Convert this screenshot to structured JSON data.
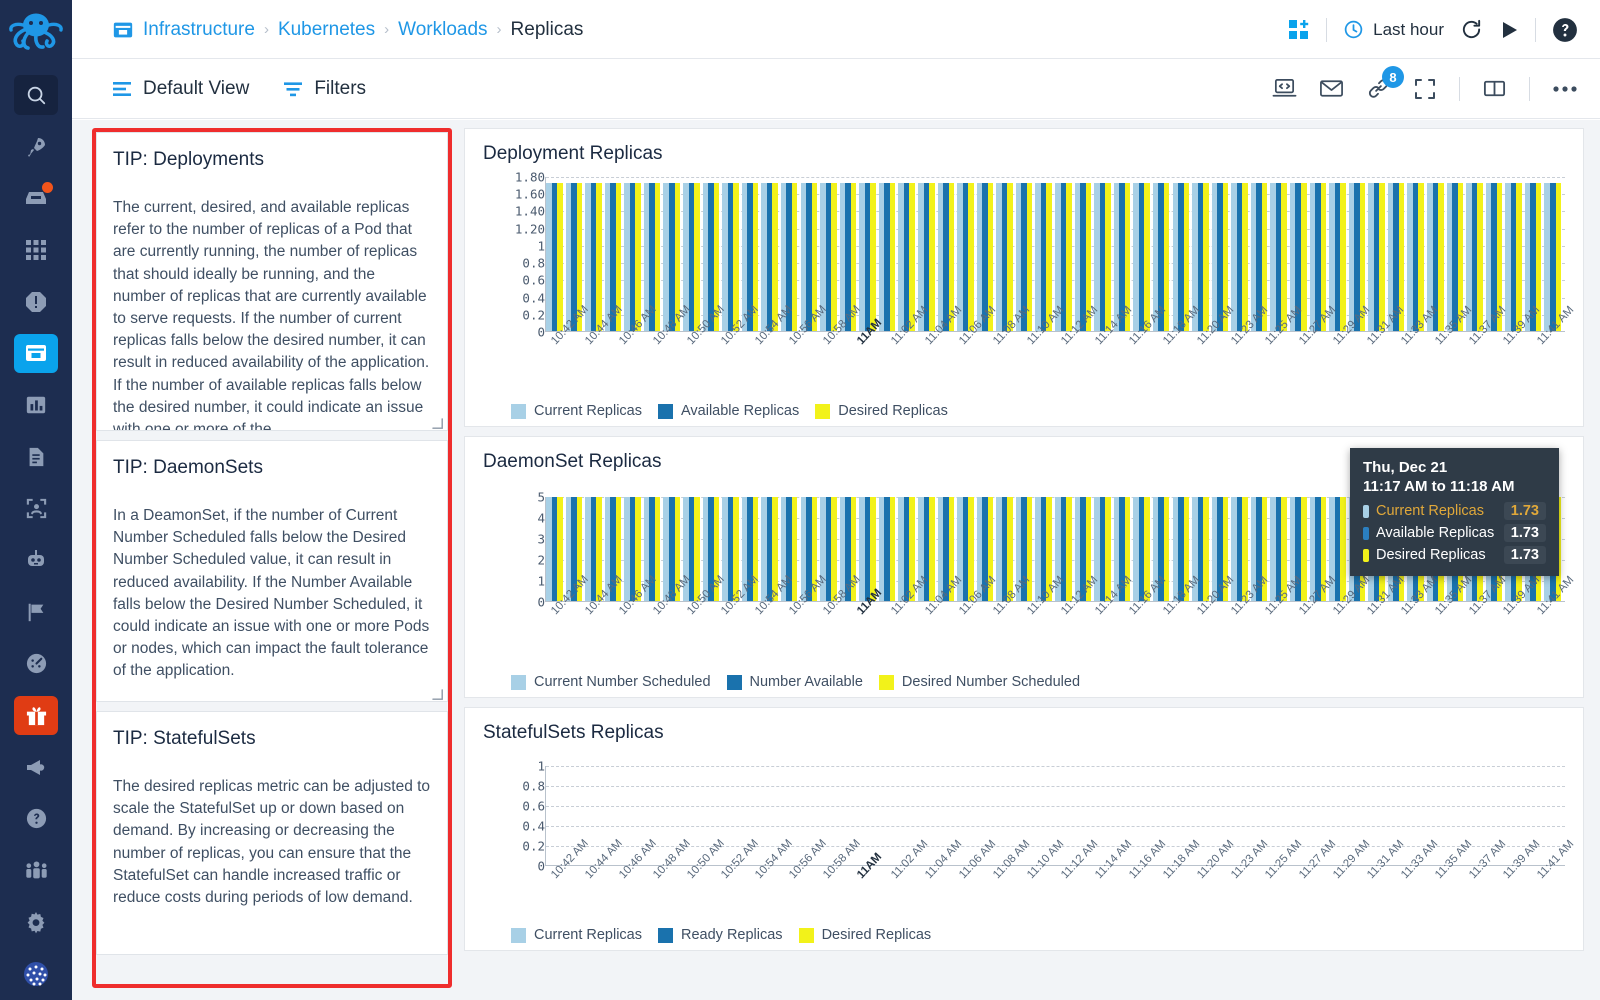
{
  "app": {
    "logo_icon": "octopus-logo",
    "rail_items": [
      {
        "name": "search",
        "icon": "search-icon",
        "state": "boxed"
      },
      {
        "name": "rocket",
        "icon": "rocket-icon",
        "state": "normal"
      },
      {
        "name": "inbox",
        "icon": "inbox-alert-icon",
        "state": "badge"
      },
      {
        "name": "apps",
        "icon": "grid-apps-icon",
        "state": "normal"
      },
      {
        "name": "alerts",
        "icon": "alert-octagon-icon",
        "state": "normal"
      },
      {
        "name": "infrastructure",
        "icon": "archive-box-icon",
        "state": "active"
      },
      {
        "name": "analytics",
        "icon": "bar-chart-icon",
        "state": "normal"
      },
      {
        "name": "logs",
        "icon": "document-icon",
        "state": "normal"
      },
      {
        "name": "user-sessions",
        "icon": "user-frame-icon",
        "state": "normal"
      },
      {
        "name": "synthetics",
        "icon": "robot-icon",
        "state": "normal"
      },
      {
        "name": "flags",
        "icon": "flag-icon",
        "state": "normal"
      },
      {
        "name": "dashboards",
        "icon": "gauge-icon",
        "state": "normal"
      },
      {
        "name": "whats-new",
        "icon": "gift-icon",
        "state": "gift"
      },
      {
        "name": "announcements",
        "icon": "megaphone-icon",
        "state": "normal"
      },
      {
        "name": "help",
        "icon": "question-circle-icon",
        "state": "normal"
      },
      {
        "name": "team",
        "icon": "people-icon",
        "state": "normal"
      },
      {
        "name": "settings",
        "icon": "gear-icon",
        "state": "normal"
      },
      {
        "name": "account",
        "icon": "globe-avatar-icon",
        "state": "normal"
      }
    ]
  },
  "header": {
    "breadcrumb_icon": "archive-box-icon",
    "breadcrumbs": [
      {
        "label": "Infrastructure",
        "link": true
      },
      {
        "label": "Kubernetes",
        "link": true
      },
      {
        "label": "Workloads",
        "link": true
      },
      {
        "label": "Replicas",
        "link": false
      }
    ],
    "separator": "›",
    "add_dashboard_icon": "add-tile-icon",
    "time_range": {
      "icon": "clock-icon",
      "label": "Last hour"
    },
    "refresh_icon": "refresh-icon",
    "play_icon": "play-icon",
    "help_icon": "help-circle-icon"
  },
  "subheader": {
    "items": [
      {
        "icon": "view-list-icon",
        "label": "Default View"
      },
      {
        "icon": "filter-icon",
        "label": "Filters"
      }
    ],
    "actions": [
      {
        "icon": "embed-code-icon",
        "name": "embed-code-button"
      },
      {
        "icon": "email-icon",
        "name": "email-button"
      },
      {
        "icon": "link-icon",
        "name": "share-link-button",
        "badge": "8"
      },
      {
        "icon": "expand-icon",
        "name": "fullscreen-button"
      },
      {
        "icon": "split-view-icon",
        "name": "layout-button"
      },
      {
        "icon": "more-icon",
        "name": "more-options-button"
      }
    ]
  },
  "tips": [
    {
      "title": "TIP: Deployments",
      "body": "The current, desired, and available replicas refer to the number of replicas of a Pod that are currently running, the number of replicas that should ideally be running, and the number of replicas that are currently available to serve requests. If the number of current replicas falls below the desired number, it can result in reduced availability of the application. If the number of available replicas falls below the desired number, it could indicate an issue with one or more of the"
    },
    {
      "title": "TIP: DaemonSets",
      "body": "In a DeamonSet, if the number of Current Number Scheduled falls below the Desired Number Scheduled value, it can result in reduced availability. If the Number Available falls below the Desired Number Scheduled, it could indicate an issue with one or more Pods or nodes, which can impact the fault tolerance of the application."
    },
    {
      "title": "TIP: StatefulSets",
      "body": "The desired replicas metric can be adjusted to scale the StatefulSet up or down based on demand. By increasing or decreasing the number of replicas, you can ensure that the StatefulSet can handle increased traffic or reduce costs during periods of low demand."
    }
  ],
  "colors": {
    "current": "#a8d0e6",
    "available": "#1a72ad",
    "desired": "#f2f21a",
    "accent": "#1f97e6",
    "rail_bg": "#1d2d50",
    "highlight_border": "#ef2d2d"
  },
  "tooltip": {
    "date": "Thu, Dec 21",
    "range": "11:17 AM to 11:18 AM",
    "rows": [
      {
        "name": "Current Replicas",
        "value": "1.73",
        "color": "#a8d0e6",
        "highlight": true
      },
      {
        "name": "Available Replicas",
        "value": "1.73",
        "color": "#2b7fc0",
        "highlight": false
      },
      {
        "name": "Desired Replicas",
        "value": "1.73",
        "color": "#f2f21a",
        "highlight": false
      }
    ]
  },
  "chart_data": [
    {
      "type": "bar",
      "title": "Deployment Replicas",
      "xlabel": "",
      "ylabel": "",
      "ylim": [
        0,
        1.8
      ],
      "grid": true,
      "legend_position": "bottom",
      "yticks": [
        "1.80",
        "1.60",
        "1.40",
        "1.20",
        "1",
        "0.8",
        "0.6",
        "0.4",
        "0.2",
        "0"
      ],
      "ytick_values": [
        1.8,
        1.6,
        1.4,
        1.2,
        1.0,
        0.8,
        0.6,
        0.4,
        0.2,
        0
      ],
      "categories": [
        "10:42 AM",
        "10:44 AM",
        "10:46 AM",
        "10:48 AM",
        "10:50 AM",
        "10:52 AM",
        "10:54 AM",
        "10:56 AM",
        "10:58 AM",
        "11AM",
        "11:02 AM",
        "11:04 AM",
        "11:06 AM",
        "11:08 AM",
        "11:10 AM",
        "11:12 AM",
        "11:14 AM",
        "11:16 AM",
        "11:18 AM",
        "11:20 AM",
        "11:23 AM",
        "11:25 AM",
        "11:27 AM",
        "11:29 AM",
        "11:31 AM",
        "11:33 AM",
        "11:35 AM",
        "11:37 AM",
        "11:39 AM",
        "11:41 AM"
      ],
      "bold_category": "11AM",
      "series": [
        {
          "name": "Current Replicas",
          "color": "#a8d0e6",
          "constant_value": 1.73
        },
        {
          "name": "Available Replicas",
          "color": "#1a72ad",
          "constant_value": 1.73
        },
        {
          "name": "Desired Replicas",
          "color": "#f2f21a",
          "constant_value": 1.73
        }
      ],
      "note": "All three series hold a flat value of 1.73 across every minute bucket"
    },
    {
      "type": "bar",
      "title": "DaemonSet Replicas",
      "xlabel": "",
      "ylabel": "",
      "ylim": [
        0,
        5
      ],
      "grid": true,
      "legend_position": "bottom",
      "yticks": [
        "5",
        "4",
        "3",
        "2",
        "1",
        "0"
      ],
      "ytick_values": [
        5,
        4,
        3,
        2,
        1,
        0
      ],
      "categories": [
        "10:42 AM",
        "10:44 AM",
        "10:46 AM",
        "10:48 AM",
        "10:50 AM",
        "10:52 AM",
        "10:54 AM",
        "10:56 AM",
        "10:58 AM",
        "11AM",
        "11:02 AM",
        "11:04 AM",
        "11:06 AM",
        "11:08 AM",
        "11:10 AM",
        "11:12 AM",
        "11:14 AM",
        "11:16 AM",
        "11:18 AM",
        "11:20 AM",
        "11:23 AM",
        "11:25 AM",
        "11:27 AM",
        "11:29 AM",
        "11:31 AM",
        "11:33 AM",
        "11:35 AM",
        "11:37 AM",
        "11:39 AM",
        "11:41 AM"
      ],
      "bold_category": "11AM",
      "series": [
        {
          "name": "Current Number Scheduled",
          "color": "#a8d0e6",
          "constant_value": 5
        },
        {
          "name": "Number Available",
          "color": "#1a72ad",
          "constant_value": 5
        },
        {
          "name": "Desired Number Scheduled",
          "color": "#f2f21a",
          "constant_value": 5
        }
      ],
      "note": "All three series hold a flat value of 5 across every minute bucket"
    },
    {
      "type": "bar",
      "title": "StatefulSets Replicas",
      "xlabel": "",
      "ylabel": "",
      "ylim": [
        0,
        1
      ],
      "grid": true,
      "legend_position": "bottom",
      "yticks": [
        "1",
        "0.8",
        "0.6",
        "0.4",
        "0.2",
        "0"
      ],
      "ytick_values": [
        1,
        0.8,
        0.6,
        0.4,
        0.2,
        0
      ],
      "categories": [
        "10:42 AM",
        "10:44 AM",
        "10:46 AM",
        "10:48 AM",
        "10:50 AM",
        "10:52 AM",
        "10:54 AM",
        "10:56 AM",
        "10:58 AM",
        "11AM",
        "11:02 AM",
        "11:04 AM",
        "11:06 AM",
        "11:08 AM",
        "11:10 AM",
        "11:12 AM",
        "11:14 AM",
        "11:16 AM",
        "11:18 AM",
        "11:20 AM",
        "11:23 AM",
        "11:25 AM",
        "11:27 AM",
        "11:29 AM",
        "11:31 AM",
        "11:33 AM",
        "11:35 AM",
        "11:37 AM",
        "11:39 AM",
        "11:41 AM"
      ],
      "bold_category": "11AM",
      "series": [
        {
          "name": "Current Replicas",
          "color": "#a8d0e6",
          "constant_value": 0
        },
        {
          "name": "Ready Replicas",
          "color": "#1a72ad",
          "constant_value": 0
        },
        {
          "name": "Desired Replicas",
          "color": "#f2f21a",
          "constant_value": 0
        }
      ],
      "note": "No data plotted — all series are empty/zero"
    }
  ]
}
